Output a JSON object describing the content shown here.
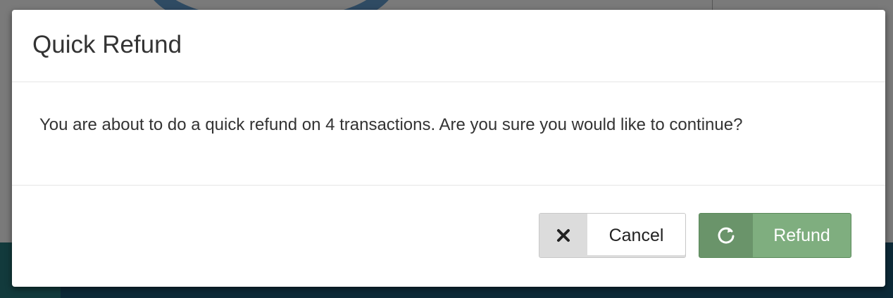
{
  "modal": {
    "title": "Quick Refund",
    "message": "You are about to do a quick refund on 4 transactions. Are you sure you would like to continue?",
    "buttons": {
      "cancel": {
        "label": "Cancel",
        "icon": "close-icon"
      },
      "refund": {
        "label": "Refund",
        "icon": "refresh-icon"
      }
    }
  },
  "colors": {
    "refund_button": "#7fae7f",
    "refund_icon_bg": "#6a946a",
    "cancel_icon_bg": "#dcdcdc"
  }
}
